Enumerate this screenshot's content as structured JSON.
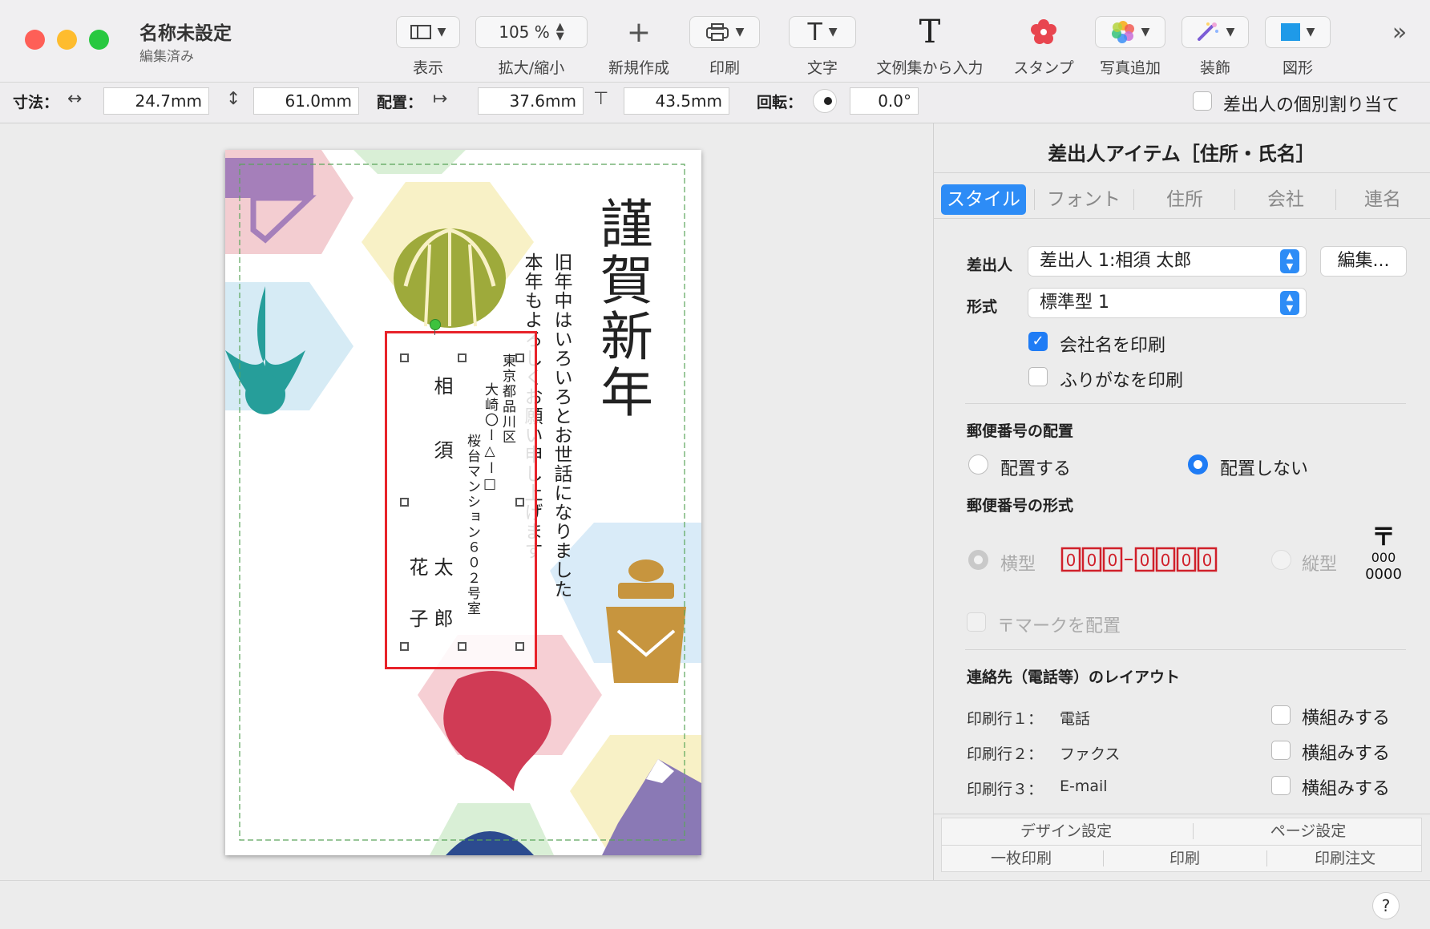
{
  "window": {
    "title": "名称未設定",
    "subtitle": "編集済み"
  },
  "toolbar": {
    "view_label": "表示",
    "zoom_value": "105 %",
    "zoom_label": "拡大/縮小",
    "new_label": "新規作成",
    "print_label": "印刷",
    "text_label": "文字",
    "phrase_label": "文例集から入力",
    "stamp_label": "スタンプ",
    "photo_label": "写真追加",
    "decor_label": "装飾",
    "shape_label": "図形"
  },
  "inspector": {
    "size_label": "寸法：",
    "width": "24.7mm",
    "height": "61.0mm",
    "position_label": "配置：",
    "pos_x": "37.6mm",
    "pos_y": "43.5mm",
    "rotation_label": "回転：",
    "rotation": "0.0°",
    "individual_label": "差出人の個別割り当て"
  },
  "card": {
    "greeting": "謹賀新年",
    "line1": "旧年中はいろいろとお世話になりました",
    "line2": "本年もよろしくお願い申し上げます",
    "address1": "東京都品川区",
    "address2": "大崎〇ー△ー□",
    "address3": "桜台マンション６０２号室",
    "name_family": "相須",
    "name1": "太郎",
    "name2": "花子"
  },
  "panel": {
    "title": "差出人アイテム［住所・氏名］",
    "tabs": [
      "スタイル",
      "フォント",
      "住所",
      "会社",
      "連名"
    ],
    "sender_label": "差出人",
    "sender_value": "差出人 1:相須 太郎",
    "edit_button": "編集...",
    "format_label": "形式",
    "format_value": "標準型 1",
    "print_company": "会社名を印刷",
    "print_furigana": "ふりがなを印刷",
    "postal_layout_heading": "郵便番号の配置",
    "place": "配置する",
    "no_place": "配置しない",
    "postal_format_heading": "郵便番号の形式",
    "horizontal": "横型",
    "vertical": "縦型",
    "postal_mark": "〒",
    "vertical_sample_top": "000",
    "vertical_sample_bottom": "0000",
    "postal_mark_label": "〒マークを配置",
    "contact_heading": "連絡先（電話等）のレイアウト",
    "rows": [
      {
        "label": "印刷行１：",
        "value": "電話",
        "option": "横組みする"
      },
      {
        "label": "印刷行２：",
        "value": "ファクス",
        "option": "横組みする"
      },
      {
        "label": "印刷行３：",
        "value": "E-mail",
        "option": "横組みする"
      }
    ],
    "bottom_buttons": [
      "デザイン設定",
      "ページ設定",
      "一枚印刷",
      "印刷",
      "印刷注文"
    ]
  },
  "status": {
    "help": "?"
  }
}
